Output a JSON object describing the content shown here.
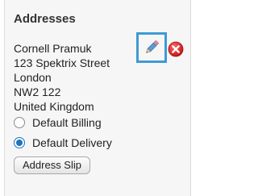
{
  "panel": {
    "title": "Addresses"
  },
  "address": {
    "lines": [
      "Cornell Pramuk",
      "123 Spektrix Street",
      "London",
      "NW2 122",
      "United Kingdom"
    ]
  },
  "actions": {
    "edit_icon": "pencil-icon",
    "delete_icon": "delete-icon",
    "highlight_color": "#3d9bd3",
    "delete_color": "#d42a2a"
  },
  "options": {
    "billing_label": "Default Billing",
    "billing_checked": false,
    "delivery_label": "Default Delivery",
    "delivery_checked": true
  },
  "buttons": {
    "address_slip_label": "Address Slip"
  }
}
